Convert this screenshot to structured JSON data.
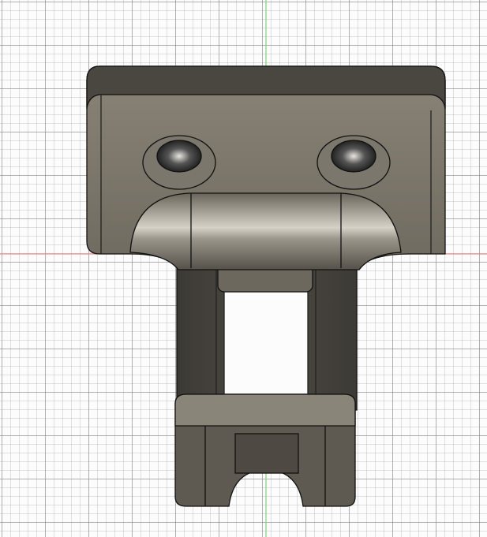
{
  "viewport": {
    "axis_x_color": "#e88a8a",
    "axis_y_color": "#7fd07f",
    "part_color": "#7a7468",
    "part_dark": "#3a3833",
    "part_light": "#b8b3a8"
  }
}
